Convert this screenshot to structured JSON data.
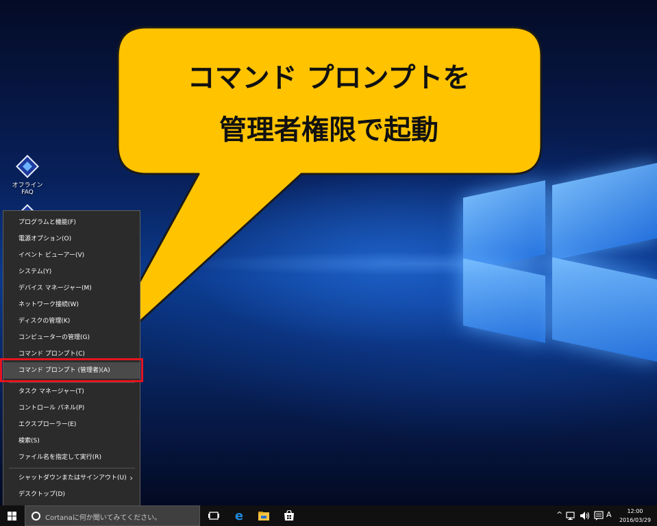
{
  "callout": {
    "line1": "コマンド プロンプトを",
    "line2": "管理者権限で起動"
  },
  "desktop_icons": [
    {
      "label": "オフラインFAQ"
    }
  ],
  "context_menu": {
    "items": [
      {
        "label": "プログラムと機能(F)"
      },
      {
        "label": "電源オプション(O)"
      },
      {
        "label": "イベント ビューアー(V)"
      },
      {
        "label": "システム(Y)"
      },
      {
        "label": "デバイス マネージャー(M)"
      },
      {
        "label": "ネットワーク接続(W)"
      },
      {
        "label": "ディスクの管理(K)"
      },
      {
        "label": "コンピューターの管理(G)"
      },
      {
        "label": "コマンド プロンプト(C)"
      },
      {
        "label": "コマンド プロンプト (管理者)(A)",
        "highlighted": true
      },
      {
        "label": "タスク マネージャー(T)"
      },
      {
        "label": "コントロール パネル(P)"
      },
      {
        "label": "エクスプローラー(E)"
      },
      {
        "label": "検索(S)"
      },
      {
        "label": "ファイル名を指定して実行(R)"
      },
      {
        "label": "シャットダウンまたはサインアウト(U)",
        "submenu": true
      },
      {
        "label": "デスクトップ(D)"
      }
    ],
    "submenu_arrow": "›",
    "highlight_color": "#e4141e"
  },
  "taskbar": {
    "search_placeholder": "Cortanaに何か聞いてみてください。",
    "pinned": [
      "task-view-icon",
      "edge-icon",
      "file-explorer-icon",
      "store-icon"
    ],
    "tray": {
      "chevron": "^",
      "network": "network-icon",
      "volume": "volume-icon",
      "notifications": "action-center-icon",
      "ime": "A"
    },
    "time": "12:00",
    "date": "2016/03/29"
  },
  "colors": {
    "callout_fill": "#ffc300",
    "callout_border": "#1a1a1a",
    "menu_bg": "#2b2b2b",
    "taskbar_bg": "#101010",
    "edge_blue": "#1f8ae0",
    "explorer_yellow": "#f5c342"
  }
}
